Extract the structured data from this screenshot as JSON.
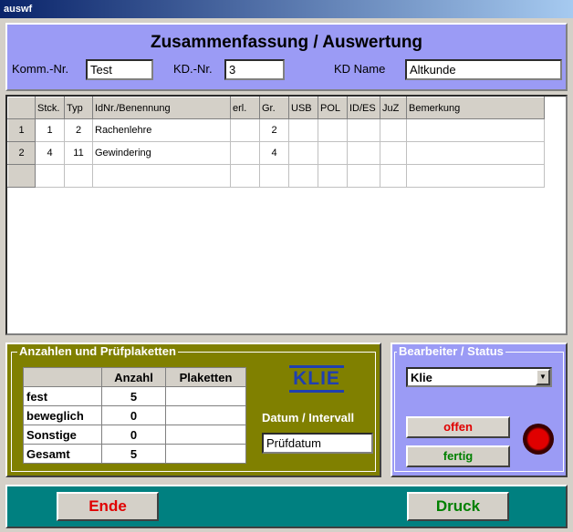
{
  "window": {
    "title": "auswf"
  },
  "header": {
    "title": "Zusammenfassung / Auswertung",
    "komm_label": "Komm.-Nr.",
    "komm_value": "Test",
    "kd_label": "KD.-Nr.",
    "kd_value": "3",
    "kdname_label": "KD Name",
    "kdname_value": "Altkunde"
  },
  "grid": {
    "columns": [
      "Stck.",
      "Typ",
      "IdNr./Benennung",
      "erl.",
      "Gr.",
      "USB",
      "POL",
      "ID/ES",
      "JuZ",
      "Bemerkung"
    ],
    "rows": [
      {
        "rownum": "1",
        "cells": [
          "1",
          "2",
          "Rachenlehre",
          "",
          "2",
          "",
          "",
          "",
          "",
          ""
        ]
      },
      {
        "rownum": "2",
        "cells": [
          "4",
          "11",
          "Gewindering",
          "",
          "4",
          "",
          "",
          "",
          "",
          ""
        ]
      },
      {
        "rownum": "",
        "cells": [
          "",
          "",
          "",
          "",
          "",
          "",
          "",
          "",
          "",
          ""
        ]
      }
    ]
  },
  "summary": {
    "legend": "Anzahlen und Prüfplaketten",
    "col_anzahl": "Anzahl",
    "col_plaketten": "Plaketten",
    "rows": [
      {
        "label": "fest",
        "anzahl": "5",
        "plaketten": ""
      },
      {
        "label": "beweglich",
        "anzahl": "0",
        "plaketten": ""
      },
      {
        "label": "Sonstige",
        "anzahl": "0",
        "plaketten": ""
      },
      {
        "label": "Gesamt",
        "anzahl": "5",
        "plaketten": ""
      }
    ],
    "logo_text": "KLIE",
    "datum_label": "Datum / Intervall",
    "datum_value": "Prüfdatum"
  },
  "status": {
    "legend": "Bearbeiter / Status",
    "bearbeiter": "Klie",
    "offen_label": "offen",
    "fertig_label": "fertig",
    "lamp_color": "#e00000"
  },
  "footer": {
    "ende_label": "Ende",
    "druck_label": "Druck"
  },
  "colors": {
    "header_bg": "#9b9bf5",
    "panel_olive": "#808000",
    "footer_teal": "#008080",
    "ende_text": "#e00000",
    "druck_text": "#008000"
  }
}
